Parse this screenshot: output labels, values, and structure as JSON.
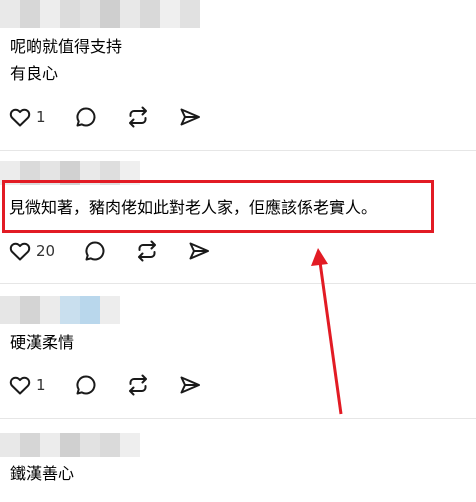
{
  "posts": [
    {
      "lines": [
        "呢啲就值得支持",
        "有良心"
      ],
      "likes": "1"
    },
    {
      "lines": [
        "見微知著，豬肉佬如此對老人家，佢應該係老實人。"
      ],
      "likes": "20"
    },
    {
      "lines": [
        "硬漢柔情"
      ],
      "likes": "1"
    },
    {
      "lines": [
        "鐵漢善心"
      ],
      "likes": ""
    }
  ],
  "icons": {
    "like": "heart-icon",
    "comment": "comment-icon",
    "repost": "repost-icon",
    "share": "send-icon"
  },
  "colors": {
    "highlight": "#e21b24",
    "divider": "#e6e6e6",
    "icon": "#1a1a1a"
  }
}
